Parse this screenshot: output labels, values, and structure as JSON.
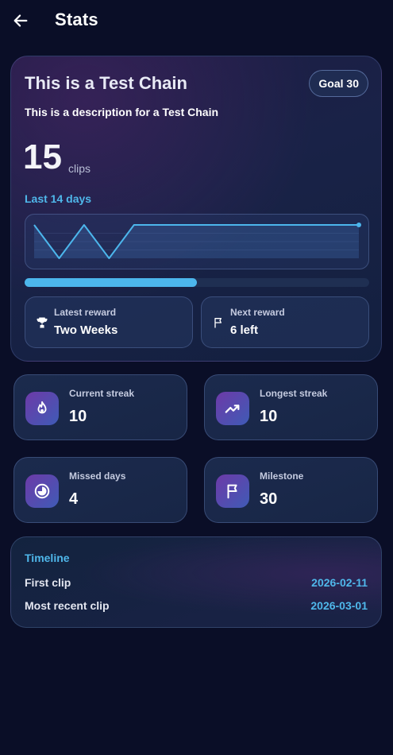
{
  "header": {
    "title": "Stats",
    "back_icon": "arrow-left-icon"
  },
  "chain": {
    "title": "This is a Test Chain",
    "goal_badge": "Goal 30",
    "description": "This is a description for a Test Chain",
    "count": "15",
    "count_unit": "clips",
    "range_label": "Last 14 days",
    "progress": 0.5,
    "colors": {
      "accent": "#4cb6ec"
    }
  },
  "chart_data": {
    "type": "line",
    "x": [
      1,
      2,
      3,
      4,
      5,
      6,
      7,
      8,
      9,
      10,
      11,
      12,
      13,
      14
    ],
    "values": [
      1,
      0,
      1,
      0,
      1,
      1,
      1,
      1,
      1,
      1,
      1,
      1,
      1,
      1
    ],
    "title": "",
    "xlabel": "",
    "ylabel": "",
    "ylim": [
      0,
      1
    ]
  },
  "rewards": {
    "latest": {
      "label": "Latest reward",
      "value": "Two Weeks",
      "icon": "trophy-icon"
    },
    "next": {
      "label": "Next reward",
      "value": "6 left",
      "icon": "flag-icon"
    }
  },
  "stats": [
    {
      "label": "Current streak",
      "value": "10",
      "icon": "flame-icon"
    },
    {
      "label": "Longest streak",
      "value": "10",
      "icon": "trending-up-icon"
    },
    {
      "label": "Missed days",
      "value": "4",
      "icon": "pie-chart-icon"
    },
    {
      "label": "Milestone",
      "value": "30",
      "icon": "flag-icon"
    }
  ],
  "timeline": {
    "title": "Timeline",
    "rows": [
      {
        "label": "First clip",
        "value": "2026-02-11"
      },
      {
        "label": "Most recent clip",
        "value": "2026-03-01"
      }
    ]
  }
}
